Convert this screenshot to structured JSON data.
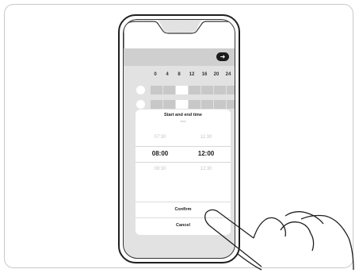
{
  "header": {
    "next_icon": "arrow-right-icon",
    "next_glyph": "➜"
  },
  "timeline": {
    "hours": [
      "0",
      "4",
      "8",
      "12",
      "16",
      "20",
      "24"
    ]
  },
  "time_picker": {
    "title": "Start and end time",
    "subtitle": "xxxx",
    "start_column": {
      "above": "07:30",
      "selected": "08:00",
      "below": "08:30"
    },
    "end_column": {
      "above": "11:30",
      "selected": "12:00",
      "below": "12:30"
    }
  },
  "actions": {
    "confirm": "Confirm",
    "cancel": "Cancel"
  },
  "colors": {
    "background": "#e2e2e2",
    "accent": "#1b1b1b",
    "sheet": "#ffffff"
  }
}
